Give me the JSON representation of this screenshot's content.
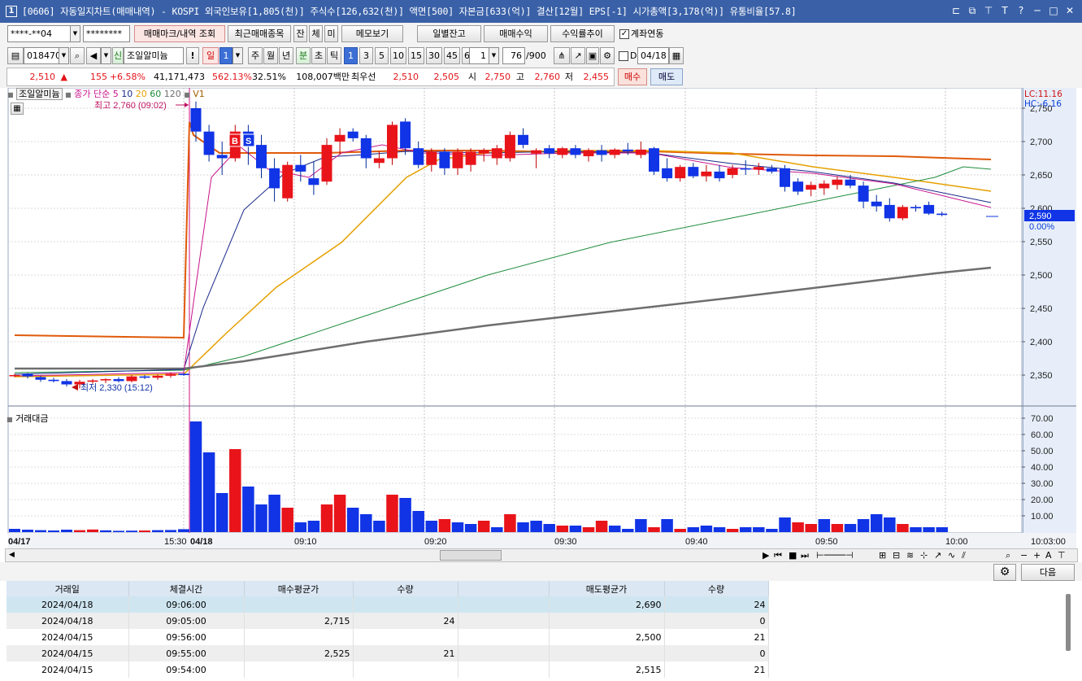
{
  "title": {
    "app_icon": "1",
    "text": "[0606] 자동일지차트(매매내역) - KOSPI 외국인보유[1,805(천)] 주식수[126,632(천)] 액면[500] 자본금[633(억)] 결산[12월] EPS[-1] 시가총액[3,178(억)] 유통비율[57.8]",
    "buttons": [
      "layout-icon",
      "restore-icon",
      "pin-icon",
      "text-icon",
      "help-icon",
      "minimize-icon",
      "maximize-icon",
      "close-icon"
    ],
    "button_glyphs": [
      "⊏",
      "⧉",
      "⊤",
      "T",
      "?",
      "─",
      "□",
      "✕"
    ]
  },
  "row1": {
    "account": "****-**04",
    "password": "********",
    "btn_trade_mark": "매매마크/내역 조회",
    "btn_recent": "최근매매종목",
    "btn_jan": "잔",
    "btn_che": "체",
    "btn_mi": "미",
    "btn_memo": "메모보기",
    "btn_daily_balance": "일별잔고",
    "btn_trade_profit": "매매수익",
    "btn_return_trend": "수익률추이",
    "account_link_label": "계좌연동",
    "account_link_checked": "✓"
  },
  "row2": {
    "code": "018470",
    "new_badge": "신",
    "name": "조일알미늄",
    "excl": "!",
    "period_day": "일",
    "period_num": "1",
    "periods": [
      "주",
      "월",
      "년",
      "분",
      "초",
      "틱"
    ],
    "minutes": [
      "1",
      "3",
      "5",
      "10",
      "15",
      "30",
      "45",
      "60"
    ],
    "min_sel": "1",
    "count": "76",
    "count_max": "/900",
    "d_label": "D",
    "date": "04/18"
  },
  "quote": {
    "price": "2,510",
    "arrow": "▲",
    "change": "155",
    "pct": "+6.58%",
    "volume": "41,171,473",
    "vol_ratio": "562.13%",
    "turnover": "32.51%",
    "amount": "108,007백만",
    "best_label": "최우선",
    "best_ask": "2,510",
    "best_bid": "2,505",
    "open_label": "시",
    "open": "2,750",
    "high_label": "고",
    "high": "2,760",
    "low_label": "저",
    "low": "2,455",
    "buy": "매수",
    "sell": "매도"
  },
  "chart": {
    "legend_name": "조일알미늄",
    "ma_label": "종가 단순",
    "ma_periods": [
      "5",
      "10",
      "20",
      "60",
      "120"
    ],
    "ma_colors": [
      "#c8148c",
      "#1a2a8a",
      "#e6a000",
      "#1e8c3c",
      "#6e6e6e"
    ],
    "v1": "V1",
    "high_note": "최고 2,760 (09:02)",
    "low_note": "최저 2,330 (15:12)",
    "lc": "LC:11.16",
    "hc": "HC:-6.16",
    "cur_price": "2,590",
    "cur_pct": "0.00%",
    "price_ticks": [
      "2,750",
      "2,700",
      "2,650",
      "2,600",
      "2,550",
      "2,500",
      "2,450",
      "2,400",
      "2,350"
    ],
    "volume_title": "거래대금",
    "volume_ticks": [
      "70.00",
      "60.00",
      "50.00",
      "40.00",
      "30.00",
      "20.00",
      "10.00"
    ],
    "time_labels": [
      "04/17",
      "15:30",
      "04/18",
      "09:10",
      "09:20",
      "09:30",
      "09:40",
      "09:50",
      "10:00"
    ],
    "time_right": "10:03:00",
    "up_color": "#e8141a",
    "down_color": "#1034e6",
    "candles": [
      [
        2350,
        2352,
        2347,
        2350
      ],
      [
        2352,
        2353,
        2345,
        2348
      ],
      [
        2347,
        2349,
        2340,
        2343
      ],
      [
        2343,
        2346,
        2339,
        2341
      ],
      [
        2341,
        2344,
        2333,
        2336
      ],
      [
        2336,
        2343,
        2330,
        2340
      ],
      [
        2340,
        2344,
        2337,
        2342
      ],
      [
        2342,
        2345,
        2338,
        2344
      ],
      [
        2344,
        2347,
        2339,
        2341
      ],
      [
        2341,
        2350,
        2339,
        2348
      ],
      [
        2348,
        2350,
        2344,
        2346
      ],
      [
        2346,
        2351,
        2343,
        2349
      ],
      [
        2349,
        2354,
        2346,
        2352
      ],
      [
        2352,
        2353,
        2349,
        2350
      ],
      [
        2750,
        2760,
        2700,
        2715
      ],
      [
        2715,
        2725,
        2670,
        2680
      ],
      [
        2680,
        2700,
        2650,
        2675
      ],
      [
        2675,
        2725,
        2670,
        2715
      ],
      [
        2715,
        2725,
        2665,
        2695
      ],
      [
        2695,
        2710,
        2645,
        2660
      ],
      [
        2660,
        2675,
        2610,
        2630
      ],
      [
        2615,
        2670,
        2610,
        2665
      ],
      [
        2665,
        2680,
        2640,
        2655
      ],
      [
        2645,
        2670,
        2620,
        2635
      ],
      [
        2640,
        2705,
        2635,
        2695
      ],
      [
        2700,
        2720,
        2680,
        2710
      ],
      [
        2715,
        2720,
        2700,
        2705
      ],
      [
        2705,
        2710,
        2660,
        2675
      ],
      [
        2668,
        2685,
        2660,
        2675
      ],
      [
        2675,
        2730,
        2665,
        2725
      ],
      [
        2730,
        2735,
        2680,
        2690
      ],
      [
        2690,
        2700,
        2660,
        2665
      ],
      [
        2665,
        2690,
        2655,
        2685
      ],
      [
        2685,
        2690,
        2650,
        2660
      ],
      [
        2660,
        2690,
        2650,
        2685
      ],
      [
        2665,
        2690,
        2655,
        2685
      ],
      [
        2682,
        2690,
        2670,
        2687
      ],
      [
        2675,
        2695,
        2665,
        2690
      ],
      [
        2675,
        2715,
        2670,
        2710
      ],
      [
        2710,
        2720,
        2690,
        2695
      ],
      [
        2682,
        2690,
        2660,
        2687
      ],
      [
        2690,
        2695,
        2675,
        2682
      ],
      [
        2680,
        2692,
        2675,
        2690
      ],
      [
        2690,
        2695,
        2675,
        2680
      ],
      [
        2678,
        2690,
        2670,
        2687
      ],
      [
        2687,
        2695,
        2670,
        2680
      ],
      [
        2680,
        2690,
        2675,
        2688
      ],
      [
        2688,
        2698,
        2680,
        2685
      ],
      [
        2680,
        2700,
        2675,
        2688
      ],
      [
        2690,
        2692,
        2650,
        2655
      ],
      [
        2660,
        2675,
        2640,
        2645
      ],
      [
        2645,
        2665,
        2640,
        2662
      ],
      [
        2662,
        2668,
        2645,
        2648
      ],
      [
        2648,
        2665,
        2640,
        2655
      ],
      [
        2655,
        2665,
        2640,
        2645
      ],
      [
        2650,
        2665,
        2645,
        2660
      ],
      [
        2660,
        2672,
        2650,
        2658
      ],
      [
        2658,
        2668,
        2650,
        2662
      ],
      [
        2660,
        2665,
        2652,
        2655
      ],
      [
        2660,
        2665,
        2625,
        2632
      ],
      [
        2640,
        2645,
        2620,
        2625
      ],
      [
        2628,
        2640,
        2618,
        2635
      ],
      [
        2630,
        2642,
        2620,
        2637
      ],
      [
        2635,
        2648,
        2628,
        2643
      ],
      [
        2643,
        2650,
        2630,
        2634
      ],
      [
        2634,
        2640,
        2600,
        2610
      ],
      [
        2610,
        2620,
        2595,
        2603
      ],
      [
        2605,
        2615,
        2580,
        2585
      ],
      [
        2585,
        2605,
        2582,
        2602
      ],
      [
        2602,
        2605,
        2595,
        2600
      ],
      [
        2605,
        2610,
        2590,
        2592
      ],
      [
        2592,
        2595,
        2588,
        2590
      ]
    ],
    "volumes": [
      [
        2,
        "d"
      ],
      [
        1.5,
        "d"
      ],
      [
        1.2,
        "d"
      ],
      [
        1,
        "d"
      ],
      [
        1.5,
        "d"
      ],
      [
        1.2,
        "u"
      ],
      [
        1.6,
        "u"
      ],
      [
        1.1,
        "d"
      ],
      [
        0.8,
        "d"
      ],
      [
        0.9,
        "d"
      ],
      [
        1,
        "u"
      ],
      [
        1.2,
        "d"
      ],
      [
        1.3,
        "d"
      ],
      [
        1.8,
        "d"
      ],
      [
        68,
        "d"
      ],
      [
        49,
        "d"
      ],
      [
        24,
        "d"
      ],
      [
        51,
        "u"
      ],
      [
        28,
        "d"
      ],
      [
        17,
        "d"
      ],
      [
        23,
        "d"
      ],
      [
        15,
        "u"
      ],
      [
        6,
        "d"
      ],
      [
        7,
        "d"
      ],
      [
        17,
        "u"
      ],
      [
        23,
        "u"
      ],
      [
        15,
        "d"
      ],
      [
        11,
        "d"
      ],
      [
        7,
        "d"
      ],
      [
        23,
        "u"
      ],
      [
        21,
        "d"
      ],
      [
        13,
        "d"
      ],
      [
        7,
        "d"
      ],
      [
        8,
        "u"
      ],
      [
        6,
        "d"
      ],
      [
        5,
        "d"
      ],
      [
        7,
        "u"
      ],
      [
        3,
        "d"
      ],
      [
        11,
        "u"
      ],
      [
        6,
        "d"
      ],
      [
        7,
        "d"
      ],
      [
        5,
        "d"
      ],
      [
        4,
        "u"
      ],
      [
        4,
        "d"
      ],
      [
        3,
        "u"
      ],
      [
        7,
        "u"
      ],
      [
        4,
        "d"
      ],
      [
        2,
        "d"
      ],
      [
        8,
        "d"
      ],
      [
        3,
        "u"
      ],
      [
        8,
        "d"
      ],
      [
        2,
        "u"
      ],
      [
        3,
        "d"
      ],
      [
        4,
        "d"
      ],
      [
        3,
        "d"
      ],
      [
        2,
        "u"
      ],
      [
        3,
        "d"
      ],
      [
        3,
        "d"
      ],
      [
        2,
        "d"
      ],
      [
        9,
        "d"
      ],
      [
        6,
        "u"
      ],
      [
        5,
        "u"
      ],
      [
        8,
        "d"
      ],
      [
        5,
        "u"
      ],
      [
        5,
        "d"
      ],
      [
        8,
        "d"
      ],
      [
        11,
        "d"
      ],
      [
        9,
        "d"
      ],
      [
        5,
        "u"
      ],
      [
        3,
        "d"
      ],
      [
        3,
        "d"
      ],
      [
        3,
        "d"
      ]
    ]
  },
  "table": {
    "headers": [
      "거래일",
      "체결시간",
      "매수평균가",
      "수량",
      "",
      "매도평균가",
      "수량"
    ],
    "rows": [
      [
        "2024/04/18",
        "09:06:00",
        "",
        "",
        "",
        "2,690",
        "24"
      ],
      [
        "2024/04/18",
        "09:05:00",
        "2,715",
        "24",
        "",
        "",
        "0"
      ],
      [
        "2024/04/15",
        "09:56:00",
        "",
        "",
        "",
        "2,500",
        "21"
      ],
      [
        "2024/04/15",
        "09:55:00",
        "2,525",
        "21",
        "",
        "",
        "0"
      ],
      [
        "2024/04/15",
        "09:54:00",
        "",
        "",
        "",
        "2,515",
        "21"
      ]
    ],
    "next_btn": "다음"
  }
}
